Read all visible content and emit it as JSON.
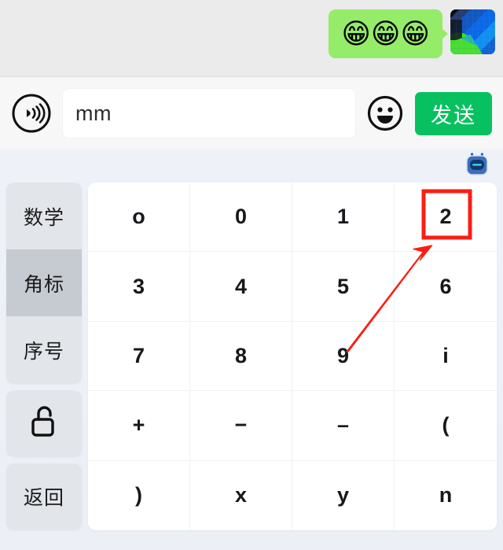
{
  "chat": {
    "message_emoji": "😁😁😁",
    "emoji_name": "grinning-face-with-smiling-eyes",
    "bubble_color": "#95ec69",
    "avatar_name": "contact-avatar"
  },
  "input_bar": {
    "voice_icon": "voice-wave-icon",
    "input_value": "mm",
    "input_placeholder": "",
    "emoji_icon": "smiley-face-icon",
    "send_label": "发送",
    "send_color": "#07c160"
  },
  "keyboard": {
    "mascot_icon": "robot-mascot-icon",
    "sidebar": [
      {
        "label": "数学",
        "name": "sidebar-item-math",
        "active": false
      },
      {
        "label": "角标",
        "name": "sidebar-item-subscript",
        "active": true
      },
      {
        "label": "序号",
        "name": "sidebar-item-ordinal",
        "active": false
      }
    ],
    "lock_icon": "unlock-icon",
    "back_label": "返回",
    "keys": [
      "o",
      "0",
      "1",
      "2",
      "3",
      "4",
      "5",
      "6",
      "7",
      "8",
      "9",
      "i",
      "+",
      "−",
      "–",
      "(",
      ")",
      "x",
      "y",
      "n"
    ],
    "highlighted_key": "2"
  },
  "annotation": {
    "box_color": "#f91f14",
    "arrow_color": "#f91f14",
    "target_key": "2"
  }
}
